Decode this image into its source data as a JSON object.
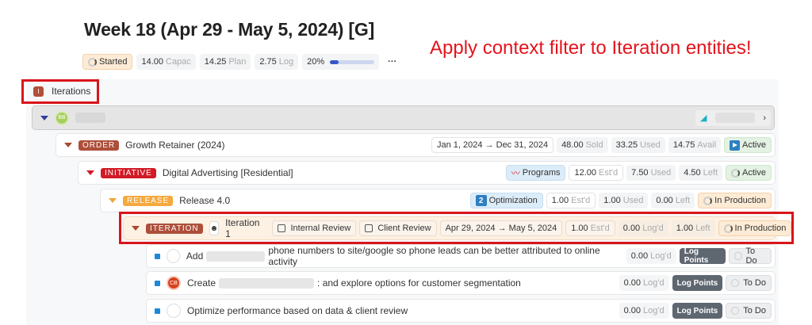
{
  "title": "Week 18 (Apr 29 - May 5, 2024) [G]",
  "annotation": "Apply context filter to Iteration entities!",
  "stats": {
    "status": "Started",
    "capac_value": "14.00",
    "capac_label": "Capac",
    "plan_value": "14.25",
    "plan_label": "Plan",
    "log_value": "2.75",
    "log_label": "Log",
    "progress_label": "20%",
    "progress": 0.2,
    "more": "···"
  },
  "section": {
    "badge": "I",
    "label": "Iterations"
  },
  "client": {
    "avatar": "BB"
  },
  "order": {
    "tag": "ORDER",
    "name": "Growth Retainer (2024)",
    "dates": "Jan 1, 2024 → Dec 31, 2024",
    "sold_value": "48.00",
    "sold_label": "Sold",
    "used_value": "33.25",
    "used_label": "Used",
    "avail_value": "14.75",
    "avail_label": "Avail",
    "status": "Active"
  },
  "initiative": {
    "tag": "INITIATIVE",
    "name": "Digital Advertising [Residential]",
    "program": "Programs",
    "est_value": "12.00",
    "est_label": "Est'd",
    "used_value": "7.50",
    "used_label": "Used",
    "left_value": "4.50",
    "left_label": "Left",
    "status": "Active"
  },
  "release": {
    "tag": "RELEASE",
    "name": "Release 4.0",
    "num": "2",
    "category": "Optimization",
    "est_value": "1.00",
    "est_label": "Est'd",
    "used_value": "1.00",
    "used_label": "Used",
    "left_value": "0.00",
    "left_label": "Left",
    "status": "In Production"
  },
  "iteration": {
    "tag": "ITERATION",
    "name": "Iteration 1",
    "internal_review": "Internal Review",
    "client_review": "Client Review",
    "dates": "Apr 29, 2024 → May 5, 2024",
    "est_value": "1.00",
    "est_label": "Est'd",
    "log_value": "0.00",
    "log_label": "Log'd",
    "left_value": "1.00",
    "left_label": "Left",
    "status": "In Production"
  },
  "tasks": [
    {
      "prefix": "Add",
      "suffix": "phone numbers to site/google so phone leads can be better attributed to online activity",
      "avatar": "",
      "log_value": "0.00",
      "log_label": "Log'd",
      "button": "Log Points",
      "status": "To Do"
    },
    {
      "prefix": "Create",
      "suffix": ": and explore options for customer segmentation",
      "avatar": "CB",
      "log_value": "0.00",
      "log_label": "Log'd",
      "button": "Log Points",
      "status": "To Do"
    },
    {
      "prefix": "Optimize performance based on data & client review",
      "suffix": "",
      "avatar": "",
      "log_value": "0.00",
      "log_label": "Log'd",
      "button": "Log Points",
      "status": "To Do"
    }
  ]
}
